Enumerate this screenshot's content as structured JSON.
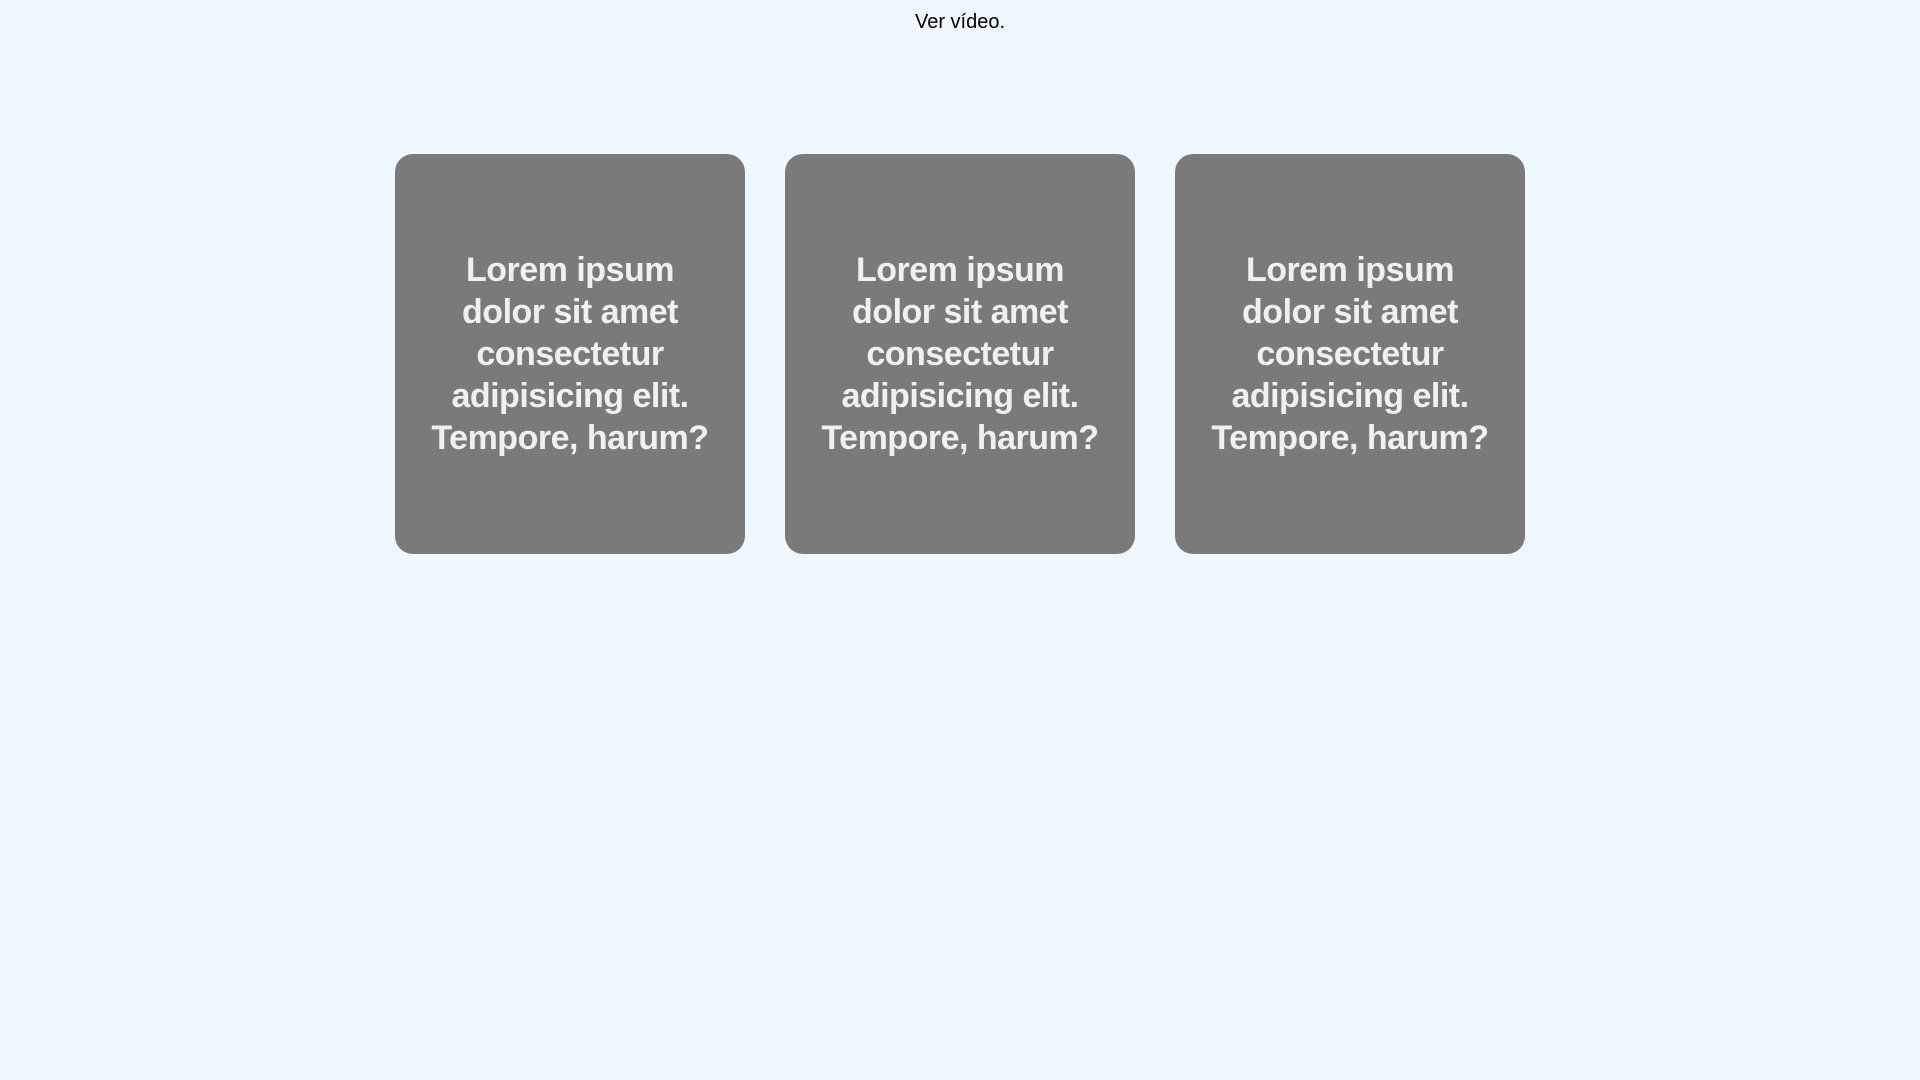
{
  "header": {
    "video_link_label": "Ver vídeo."
  },
  "cards": [
    {
      "text": "Lorem ipsum dolor sit amet consectetur adipisicing elit. Tempore, harum?"
    },
    {
      "text": "Lorem ipsum dolor sit amet consectetur adipisicing elit. Tempore, harum?"
    },
    {
      "text": "Lorem ipsum dolor sit amet consectetur adipisicing elit. Tempore, harum?"
    }
  ],
  "colors": {
    "background": "#f0f8ff",
    "card": "#7a7a7a",
    "card_text": "#f0f0f0"
  }
}
